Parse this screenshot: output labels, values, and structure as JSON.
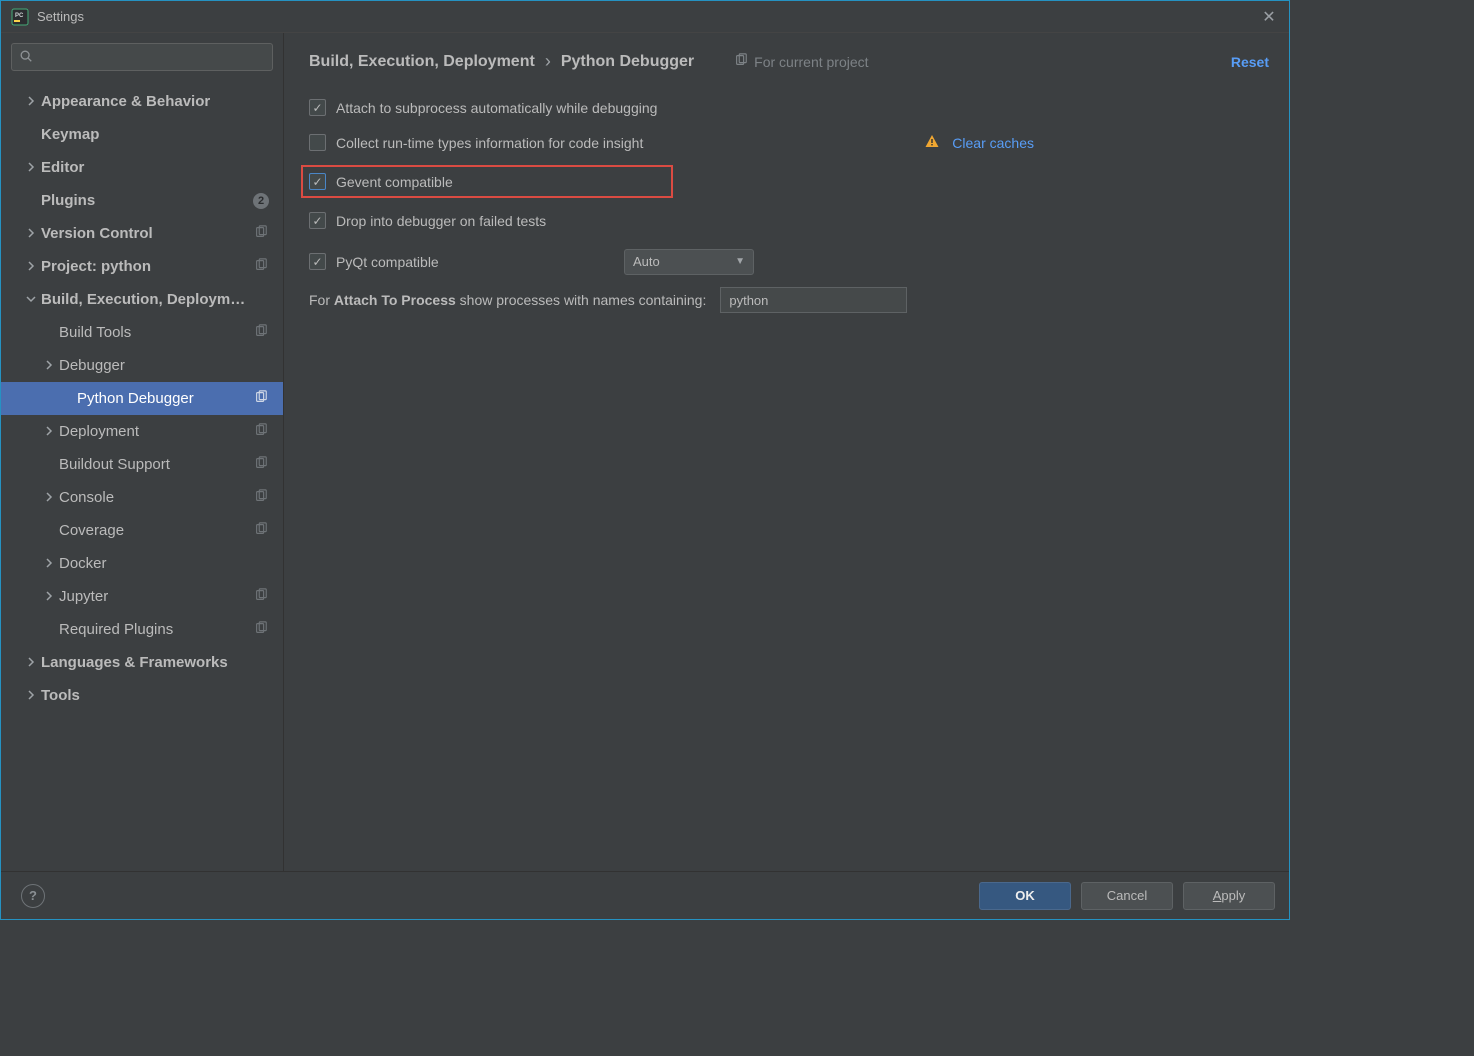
{
  "window": {
    "title": "Settings"
  },
  "sidebar": {
    "search_placeholder": "",
    "items": [
      {
        "label": "Appearance & Behavior",
        "indent": 0,
        "chevron": "right",
        "bold": true
      },
      {
        "label": "Keymap",
        "indent": 0,
        "chevron": "",
        "bold": true
      },
      {
        "label": "Editor",
        "indent": 0,
        "chevron": "right",
        "bold": true
      },
      {
        "label": "Plugins",
        "indent": 0,
        "chevron": "",
        "bold": true,
        "badge_count": "2"
      },
      {
        "label": "Version Control",
        "indent": 0,
        "chevron": "right",
        "bold": true,
        "copy_badge": true
      },
      {
        "label": "Project: python",
        "indent": 0,
        "chevron": "right",
        "bold": true,
        "copy_badge": true
      },
      {
        "label": "Build, Execution, Deployment",
        "indent": 0,
        "chevron": "down",
        "bold": true
      },
      {
        "label": "Build Tools",
        "indent": 1,
        "chevron": "",
        "copy_badge": true
      },
      {
        "label": "Debugger",
        "indent": 1,
        "chevron": "right"
      },
      {
        "label": "Python Debugger",
        "indent": 2,
        "chevron": "",
        "selected": true,
        "copy_badge": true
      },
      {
        "label": "Deployment",
        "indent": 1,
        "chevron": "right",
        "copy_badge": true
      },
      {
        "label": "Buildout Support",
        "indent": 1,
        "chevron": "",
        "copy_badge": true
      },
      {
        "label": "Console",
        "indent": 1,
        "chevron": "right",
        "copy_badge": true
      },
      {
        "label": "Coverage",
        "indent": 1,
        "chevron": "",
        "copy_badge": true
      },
      {
        "label": "Docker",
        "indent": 1,
        "chevron": "right"
      },
      {
        "label": "Jupyter",
        "indent": 1,
        "chevron": "right",
        "copy_badge": true
      },
      {
        "label": "Required Plugins",
        "indent": 1,
        "chevron": "",
        "copy_badge": true
      },
      {
        "label": "Languages & Frameworks",
        "indent": 0,
        "chevron": "right",
        "bold": true
      },
      {
        "label": "Tools",
        "indent": 0,
        "chevron": "right",
        "bold": true
      }
    ]
  },
  "breadcrumb": {
    "part1": "Build, Execution, Deployment",
    "part2": "Python Debugger"
  },
  "header": {
    "project_note": "For current project",
    "reset": "Reset"
  },
  "settings": {
    "attach_subprocess": {
      "label": "Attach to subprocess automatically while debugging",
      "checked": true
    },
    "collect_types": {
      "label": "Collect run-time types information for code insight",
      "checked": false
    },
    "gevent_compatible": {
      "label": "Gevent compatible",
      "checked": true,
      "highlight": true
    },
    "drop_on_failed": {
      "label": "Drop into debugger on failed tests",
      "checked": true
    },
    "pyqt_compat": {
      "label": "PyQt compatible",
      "checked": true,
      "select_value": "Auto"
    },
    "clear_caches": "Clear caches",
    "process_prefix": "For ",
    "process_bold": "Attach To Process",
    "process_suffix": " show processes with names containing:",
    "process_value": "python"
  },
  "footer": {
    "ok": "OK",
    "cancel": "Cancel",
    "apply": "Apply",
    "help": "?"
  }
}
